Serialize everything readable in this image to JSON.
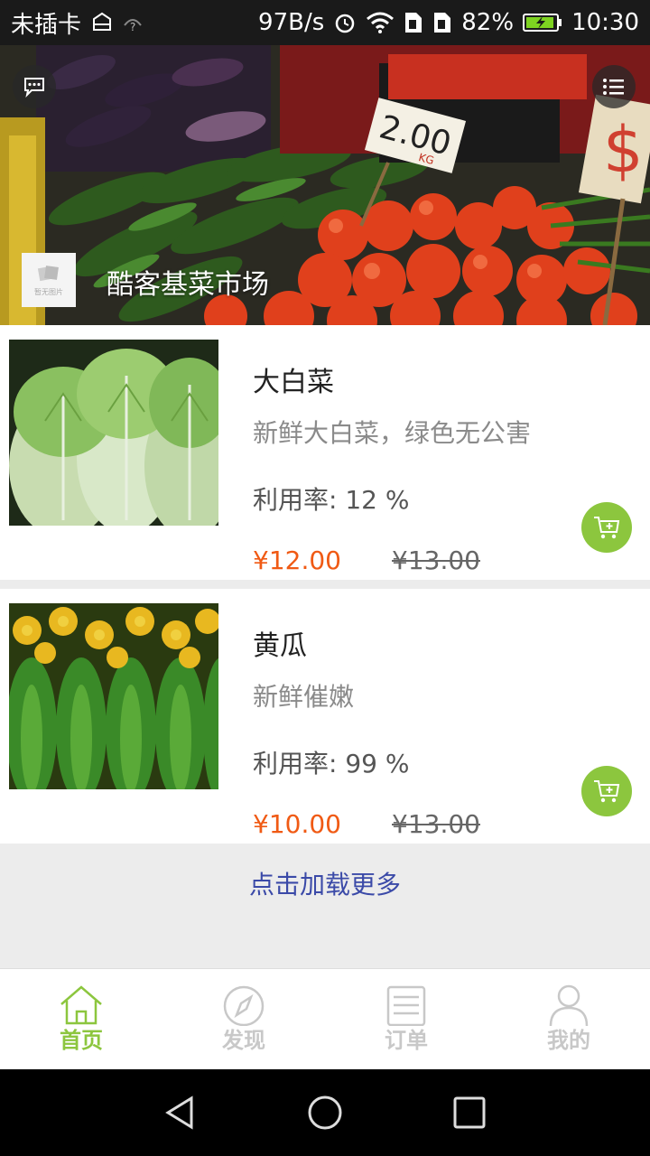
{
  "status_bar": {
    "carrier": "未插卡",
    "net_speed": "97B/s",
    "battery": "82%",
    "time": "10:30"
  },
  "banner": {
    "market_name": "酷客基菜市场",
    "logo_caption": "暂无图片",
    "price_sign": "2.00",
    "price_unit": "KG",
    "icons": {
      "message": "chat-bubble-icon",
      "menu": "list-menu-icon"
    }
  },
  "products": [
    {
      "name": "大白菜",
      "desc": "新鲜大白菜，绿色无公害",
      "rate": "利用率: 12 %",
      "price": "¥12.00",
      "original_price": "¥13.00"
    },
    {
      "name": "黄瓜",
      "desc": "新鲜催嫩",
      "rate": "利用率: 99 %",
      "price": "¥10.00",
      "original_price": "¥13.00"
    }
  ],
  "load_more": "点击加载更多",
  "tabs": [
    {
      "label": "首页",
      "icon": "home-icon",
      "active": true
    },
    {
      "label": "发现",
      "icon": "compass-icon",
      "active": false
    },
    {
      "label": "订单",
      "icon": "order-list-icon",
      "active": false
    },
    {
      "label": "我的",
      "icon": "user-icon",
      "active": false
    }
  ],
  "colors": {
    "accent": "#8cc63e",
    "price": "#f05a14",
    "link": "#3b4aa8"
  }
}
